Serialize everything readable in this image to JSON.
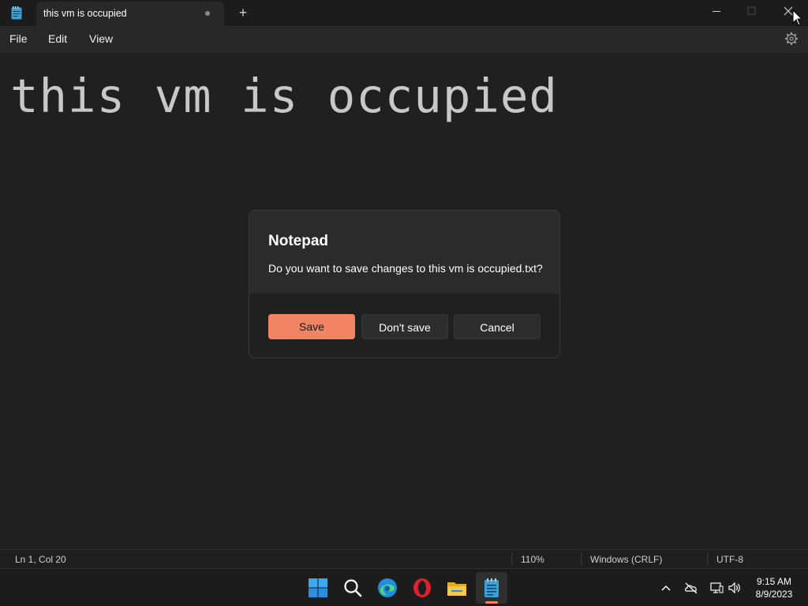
{
  "window": {
    "tab_title": "this vm is occupied",
    "new_tab_symbol": "+"
  },
  "menu": {
    "file": "File",
    "edit": "Edit",
    "view": "View"
  },
  "editor": {
    "content": "this vm is occupied"
  },
  "dialog": {
    "title": "Notepad",
    "message": "Do you want to save changes to this vm is occupied.txt?",
    "save_label": "Save",
    "dont_save_label": "Don't save",
    "cancel_label": "Cancel"
  },
  "status": {
    "position": "Ln 1, Col 20",
    "zoom": "110%",
    "line_ending": "Windows (CRLF)",
    "encoding": "UTF-8"
  },
  "taskbar": {
    "apps": [
      "start-icon",
      "search-icon",
      "edge-icon",
      "opera-icon",
      "file-explorer-icon",
      "notepad-icon"
    ],
    "tray": [
      "chevron-up-icon",
      "onedrive-icon",
      "network-icon",
      "volume-icon"
    ],
    "time": "9:15 AM",
    "date": "8/9/2023"
  },
  "colors": {
    "accent": "#f08463",
    "background": "#202020"
  }
}
